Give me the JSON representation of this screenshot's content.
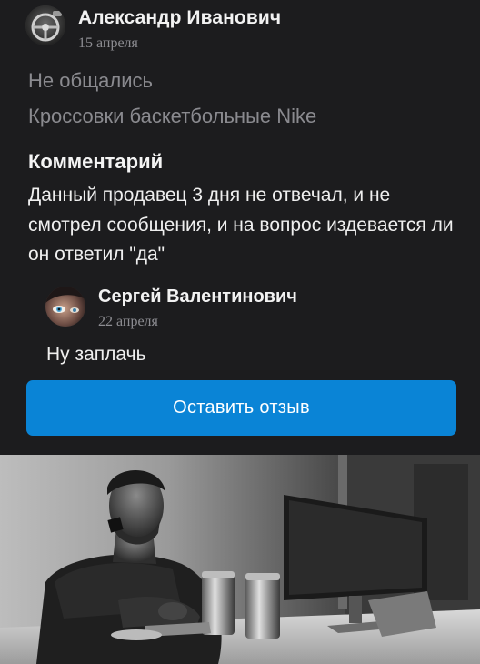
{
  "review": {
    "author_name": "Александр Иванович",
    "date": "15 апреля",
    "status": "Не общались",
    "item": "Кроссовки баскетбольные Nike",
    "comment_heading": "Комментарий",
    "comment_text": "Данный продавец 3 дня не отвечал, и не смотрел сообщения, и на вопрос издевается ли он ответил \"да\""
  },
  "reply": {
    "author_name": "Сергей Валентинович",
    "date": "22 апреля",
    "text": "Ну заплачь"
  },
  "action": {
    "leave_review_label": "Оставить отзыв"
  },
  "colors": {
    "card_background": "#1c1c1e",
    "button_blue": "#0a84d6",
    "secondary_text": "#8a8a8f"
  },
  "icons": {
    "author_avatar": "steering-wheel-avatar",
    "reply_avatar": "face-closeup-avatar",
    "photo": "man-at-computer-photo"
  }
}
